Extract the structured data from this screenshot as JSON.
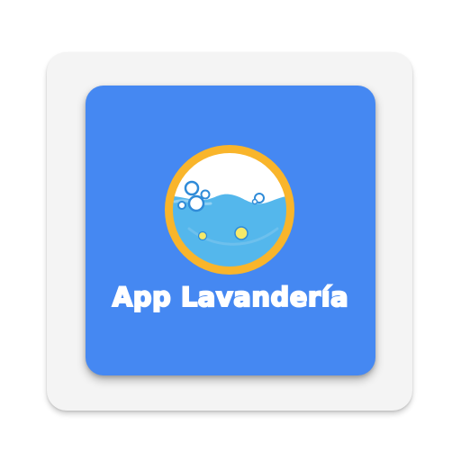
{
  "app": {
    "name": "App Lavandería"
  },
  "colors": {
    "tile_background": "#4588f2",
    "ring": "#f9b52b",
    "water": "#54b7ec",
    "bubbles_highlight": "#ffffff",
    "yellow_dots": "#f6e96a"
  },
  "icons": {
    "logo": "washing-machine-bubble-icon"
  }
}
